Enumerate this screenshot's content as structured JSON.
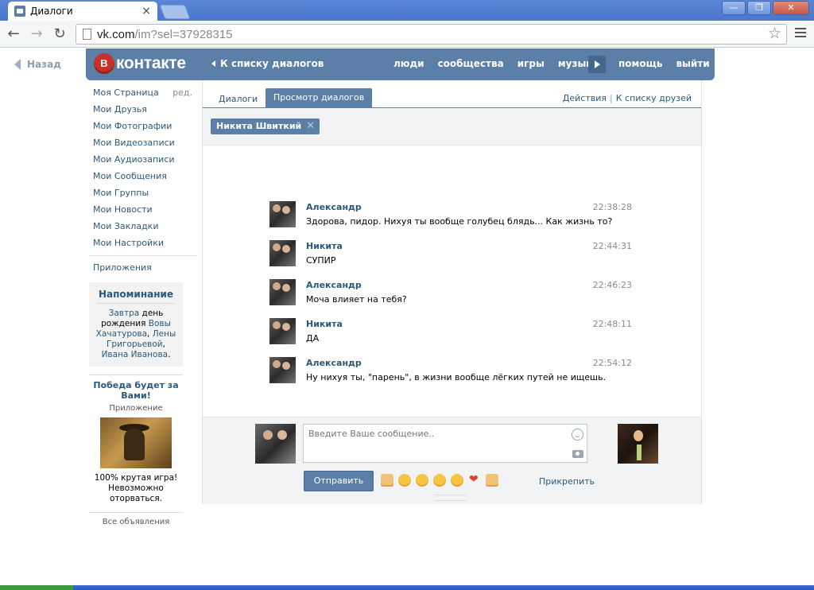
{
  "browser": {
    "tab_title": "Диалоги",
    "tab_close": "×",
    "url_host": "vk.com",
    "url_path": "/im?sel=37928315",
    "win_min": "—",
    "win_max": "❐",
    "win_close": "✕"
  },
  "back": {
    "label": "Назад"
  },
  "header": {
    "logo_badge": "B",
    "logo_text": "контакте",
    "back_to_list": "К списку диалогов",
    "nav": [
      "люди",
      "сообщества",
      "игры",
      "музыка"
    ],
    "nav2": [
      "помощь",
      "выйти"
    ]
  },
  "sidebar": {
    "items": [
      "Моя Страница",
      "Мои Друзья",
      "Мои Фотографии",
      "Мои Видеозаписи",
      "Мои Аудиозаписи",
      "Мои Сообщения",
      "Мои Группы",
      "Мои Новости",
      "Мои Закладки",
      "Мои Настройки"
    ],
    "edit_label": "ред.",
    "apps": "Приложения",
    "reminder": {
      "title": "Напоминание",
      "t1": "Завтра",
      "t2": " день рождения ",
      "t3": "Вовы Хачатурова",
      "t4": ", ",
      "t5": "Лены Григорьевой",
      "t6": ", ",
      "t7": "Ивана Иванова",
      "t8": "."
    },
    "ad": {
      "title": "Победа будет за Вами!",
      "subtitle": "Приложение",
      "text": "100% крутая игра! Невозможно оторваться.",
      "footer": "Все объявления"
    }
  },
  "main": {
    "tab_dialogs": "Диалоги",
    "tab_view": "Просмотр диалогов",
    "actions": "Действия",
    "friends_list": "К списку друзей",
    "actions_sep": "|",
    "peer_name": "Никита Швиткий",
    "chip_close": "✕",
    "messages": [
      {
        "author": "Александр",
        "time": "22:38:28",
        "text": "Здорова, пидор. Нихуя ты вообще голубец блядь... Как жизнь то?"
      },
      {
        "author": "Никита",
        "time": "22:44:31",
        "text": "СУПИР"
      },
      {
        "author": "Александр",
        "time": "22:46:23",
        "text": "Моча влияет на тебя?"
      },
      {
        "author": "Никита",
        "time": "22:48:11",
        "text": "ДА"
      },
      {
        "author": "Александр",
        "time": "22:54:12",
        "text": "Ну нихуя ты, \"парень\", в жизни вообще лёгких путей не ищешь."
      }
    ],
    "composer": {
      "placeholder": "Введите Ваше сообщение..",
      "send": "Отправить",
      "attach": "Прикрепить"
    }
  },
  "colors": {
    "brand": "#5b7fa6",
    "link": "#2b587a",
    "muted": "#8a8a8a"
  }
}
